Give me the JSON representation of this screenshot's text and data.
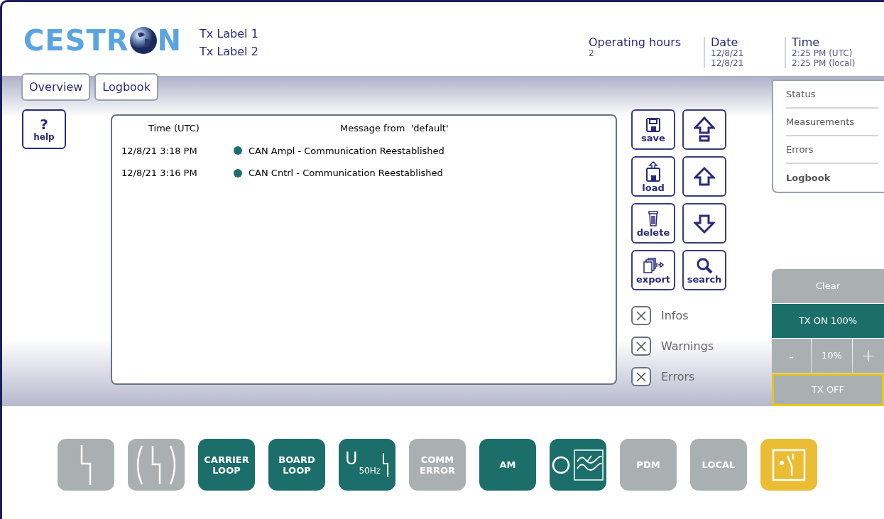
{
  "header": {
    "logo": {
      "before": "CESTR",
      "after": "N"
    },
    "tx_labels": [
      "Tx Label 1",
      "Tx Label 2"
    ],
    "info": [
      {
        "title": "Operating hours",
        "lines": [
          "2"
        ]
      },
      {
        "title": "Date",
        "lines": [
          "12/8/21",
          "12/8/21"
        ]
      },
      {
        "title": "Time",
        "lines": [
          "2:25 PM (UTC)",
          "2:25 PM (local)"
        ]
      }
    ]
  },
  "tabs": [
    "Overview",
    "Logbook"
  ],
  "help": {
    "glyph": "?",
    "label": "help"
  },
  "log": {
    "columns": [
      "Time (UTC)",
      "Message from  'default'"
    ],
    "rows": [
      {
        "time": "12/8/21 3:18 PM",
        "color": "#1c6e6b",
        "message": "CAN Ampl - Communication Reestablished"
      },
      {
        "time": "12/8/21 3:16 PM",
        "color": "#1c6e6b",
        "message": "CAN Cntrl - Communication Reestablished"
      }
    ]
  },
  "actions": [
    {
      "kind": "save",
      "label": "save"
    },
    {
      "kind": "top"
    },
    {
      "kind": "load",
      "label": "load"
    },
    {
      "kind": "up"
    },
    {
      "kind": "delete",
      "label": "delete"
    },
    {
      "kind": "down"
    },
    {
      "kind": "export",
      "label": "export"
    },
    {
      "kind": "search",
      "label": "search"
    }
  ],
  "filters": [
    {
      "label": "Infos",
      "checked": true
    },
    {
      "label": "Warnings",
      "checked": true
    },
    {
      "label": "Errors",
      "checked": true
    }
  ],
  "menu": [
    {
      "label": "Status",
      "selected": false
    },
    {
      "label": "Measurements",
      "selected": false
    },
    {
      "label": "Errors",
      "selected": false
    },
    {
      "label": "Logbook",
      "selected": true
    }
  ],
  "tx_panel": {
    "clear": "Clear",
    "tx_on": {
      "label": "TX ON 100%",
      "active": true
    },
    "minus": "-",
    "step": "10%",
    "plus": "+",
    "tx_off": {
      "label": "TX OFF",
      "highlighted": true
    }
  },
  "indicators": [
    {
      "kind": "fault",
      "color": "#aab0b1"
    },
    {
      "kind": "fault-bracket",
      "color": "#aab0b1"
    },
    {
      "kind": "text",
      "lines": [
        "CARRIER",
        "LOOP"
      ],
      "color": "#1c6e6b"
    },
    {
      "kind": "text",
      "lines": [
        "BOARD",
        "LOOP"
      ],
      "color": "#1c6e6b"
    },
    {
      "kind": "supply",
      "main": "U",
      "sub": "50Hz",
      "color": "#1c6e6b"
    },
    {
      "kind": "text",
      "lines": [
        "COMM",
        "ERROR"
      ],
      "color": "#aab0b1"
    },
    {
      "kind": "text",
      "lines": [
        "AM"
      ],
      "color": "#1c6e6b"
    },
    {
      "kind": "scope",
      "color": "#1c6e6b"
    },
    {
      "kind": "text",
      "lines": [
        "PDM"
      ],
      "color": "#aab0b1"
    },
    {
      "kind": "text",
      "lines": [
        "LOCAL"
      ],
      "color": "#aab0b1"
    },
    {
      "kind": "switch",
      "color": "#ebbd34"
    }
  ]
}
